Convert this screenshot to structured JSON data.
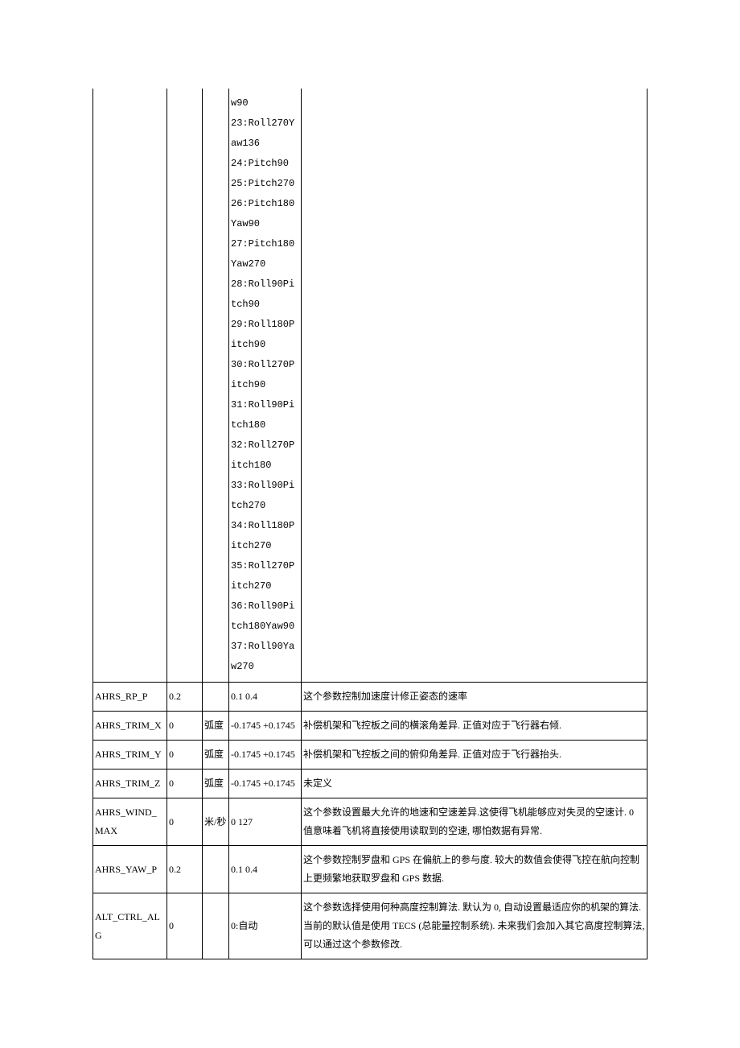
{
  "rows": [
    {
      "param": "",
      "default": "",
      "unit": "",
      "range": "w90\n23:Roll270Yaw136\n24:Pitch90\n25:Pitch270\n26:Pitch180Yaw90\n27:Pitch180Yaw270\n28:Roll90Pitch90\n29:Roll180Pitch90\n30:Roll270Pitch90\n31:Roll90Pitch180\n32:Roll270Pitch180\n33:Roll90Pitch270\n34:Roll180Pitch270\n35:Roll270Pitch270\n36:Roll90Pitch180Yaw90\n37:Roll90Yaw270",
      "desc": ""
    },
    {
      "param": "AHRS_RP_P",
      "default": "0.2",
      "unit": "",
      "range": "0.1 0.4",
      "desc": "这个参数控制加速度计修正姿态的速率"
    },
    {
      "param": "AHRS_TRIM_X",
      "default": "0",
      "unit": "弧度",
      "range": "-0.1745 +0.1745",
      "desc": "补偿机架和飞控板之间的横滚角差异. 正值对应于飞行器右倾."
    },
    {
      "param": "AHRS_TRIM_Y",
      "default": "0",
      "unit": "弧度",
      "range": "-0.1745 +0.1745",
      "desc": "补偿机架和飞控板之间的俯仰角差异. 正值对应于飞行器抬头."
    },
    {
      "param": "AHRS_TRIM_Z",
      "default": "0",
      "unit": "弧度",
      "range": "-0.1745 +0.1745",
      "desc": "未定义"
    },
    {
      "param": "AHRS_WIND_MAX",
      "default": "0",
      "unit": "米/秒",
      "range": "0 127",
      "desc": "这个参数设置最大允许的地速和空速差异.这使得飞机能够应对失灵的空速计. 0 值意味着飞机将直接使用读取到的空速, 哪怕数据有异常."
    },
    {
      "param": "AHRS_YAW_P",
      "default": "0.2",
      "unit": "",
      "range": "0.1 0.4",
      "desc": "这个参数控制罗盘和 GPS 在偏航上的参与度. 较大的数值会使得飞控在航向控制上更频繁地获取罗盘和 GPS 数据."
    },
    {
      "param": "ALT_CTRL_ALG",
      "default": "0",
      "unit": "",
      "range": "0:自动",
      "desc": "这个参数选择使用何种高度控制算法. 默认为 0, 自动设置最适应你的机架的算法. 当前的默认值是使用 TECS (总能量控制系统). 未来我们会加入其它高度控制算法, 可以通过这个参数修改."
    }
  ]
}
